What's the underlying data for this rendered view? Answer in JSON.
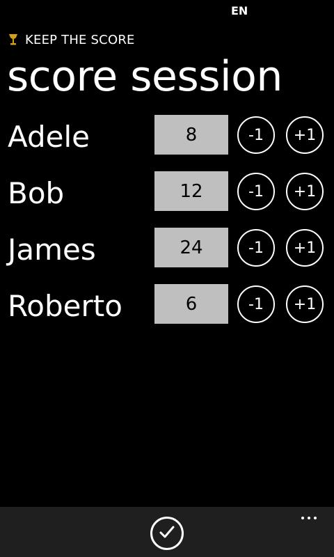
{
  "status_bar": {
    "language": "EN"
  },
  "app": {
    "title": "KEEP THE SCORE",
    "icon": "trophy-icon",
    "accent_color": "#d4a017"
  },
  "page": {
    "title": "score session"
  },
  "players": [
    {
      "name": "Adele",
      "score": "8",
      "minus_label": "-1",
      "plus_label": "+1"
    },
    {
      "name": "Bob",
      "score": "12",
      "minus_label": "-1",
      "plus_label": "+1"
    },
    {
      "name": "James",
      "score": "24",
      "minus_label": "-1",
      "plus_label": "+1"
    },
    {
      "name": "Roberto",
      "score": "6",
      "minus_label": "-1",
      "plus_label": "+1"
    }
  ],
  "app_bar": {
    "primary_icon": "check-icon",
    "more_icon": "ellipsis-icon",
    "background": "#1f1f1f"
  },
  "colors": {
    "background": "#000000",
    "foreground": "#ffffff",
    "score_box": "#bfbfbf"
  }
}
